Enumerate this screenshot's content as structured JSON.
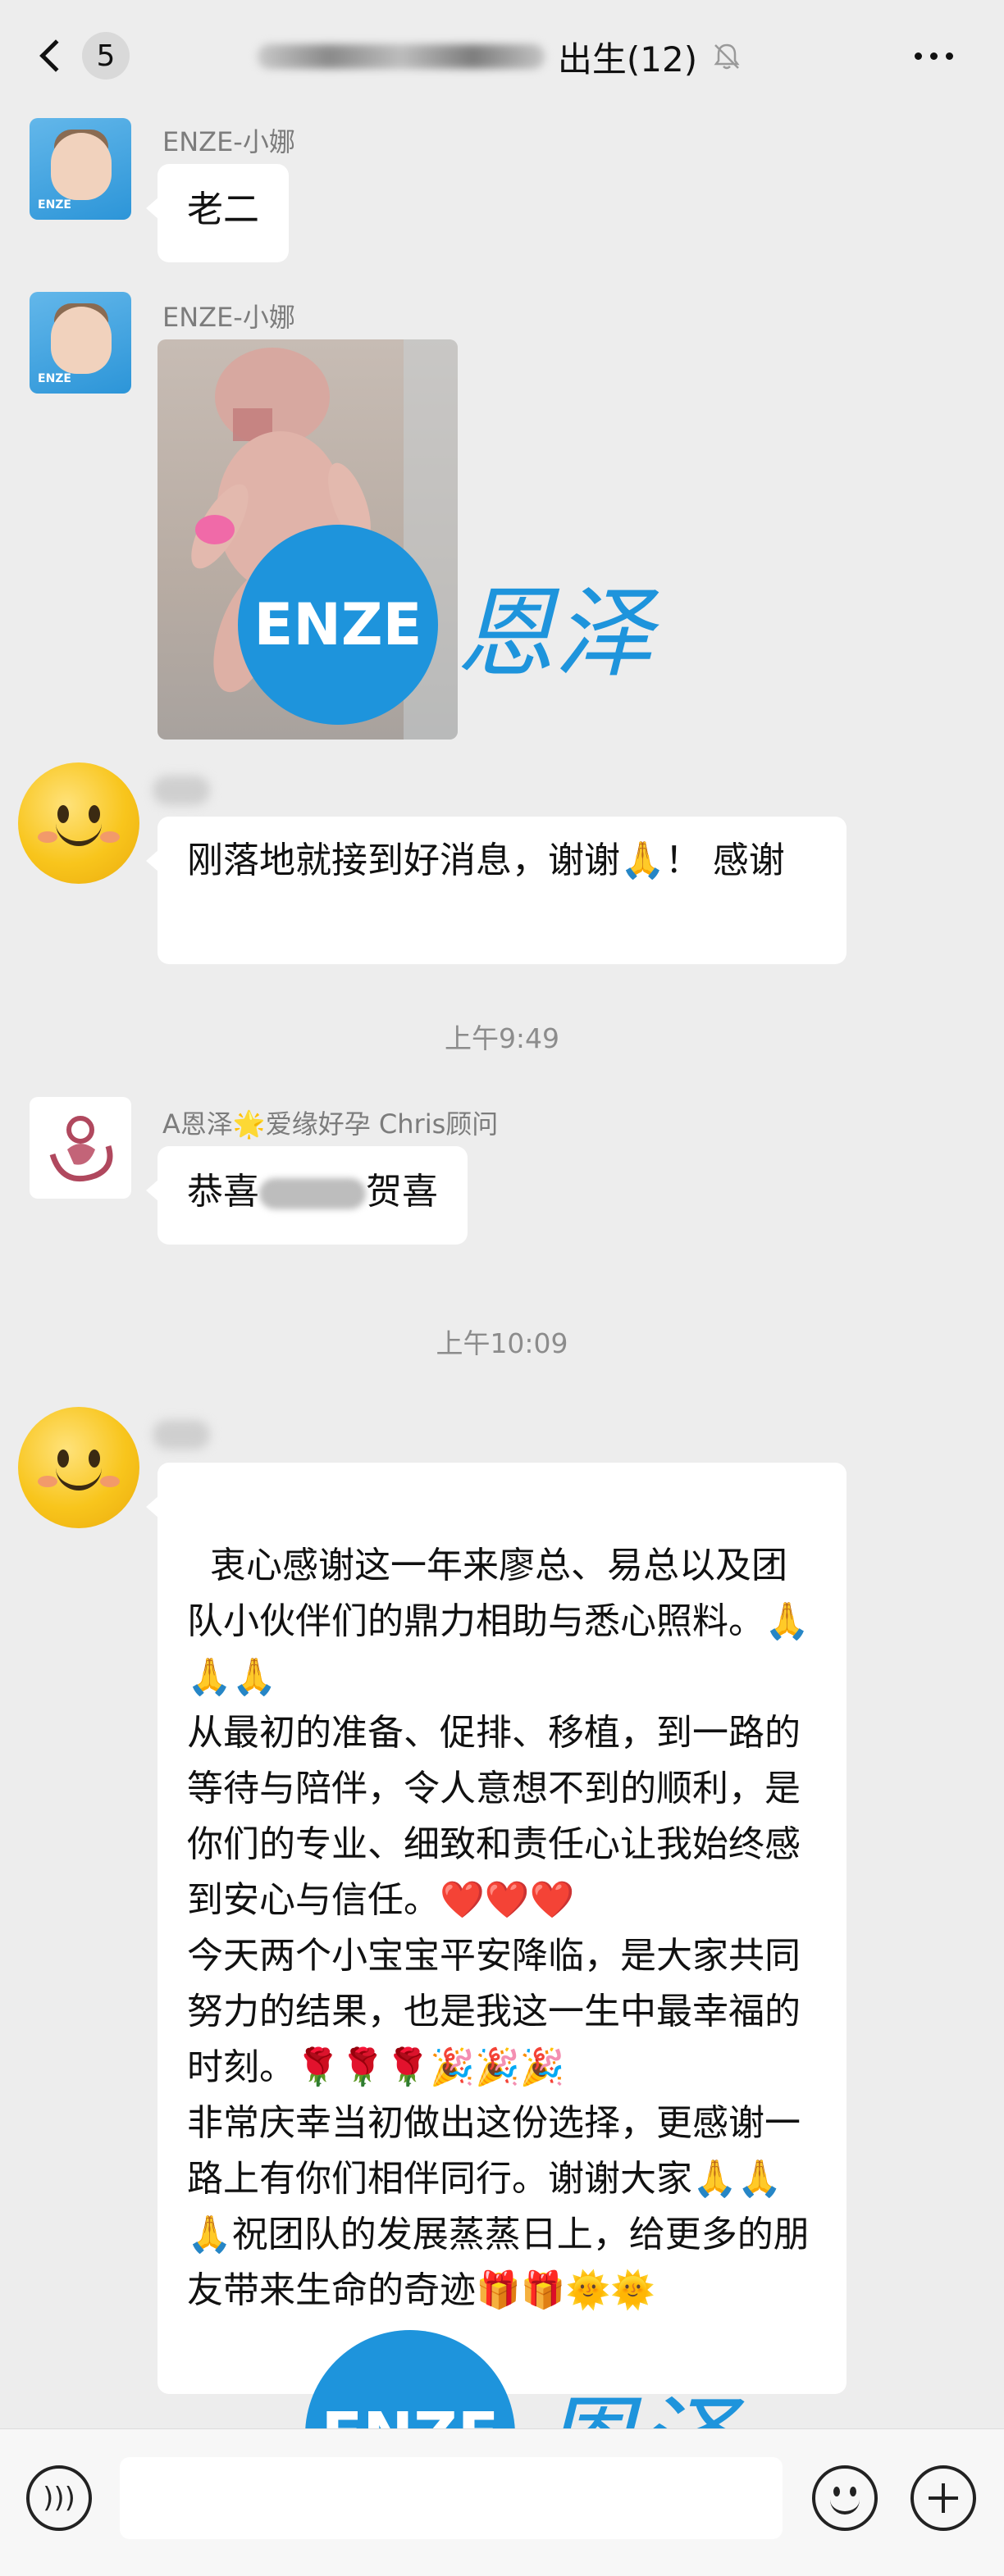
{
  "header": {
    "unread_count": "5",
    "group_title_visible": "出生(12)",
    "back_icon": "chevron-left-icon",
    "mute_icon": "bell-off-icon",
    "more_icon": "more-dots-icon"
  },
  "messages": [
    {
      "sender": "ENZE-小娜",
      "text": "老二"
    },
    {
      "sender": "ENZE-小娜",
      "type": "image"
    },
    {
      "text": "刚落地就接到好消息，谢谢🙏！ 感谢"
    },
    {
      "sender": "A恩泽🌟爱缘好孕 Chris顾问",
      "text_before": "恭喜",
      "text_after": "贺喜"
    },
    {
      "text": "衷心感谢这一年来廖总、易总以及团队小伙伴们的鼎力相助与悉心照料。🙏🙏🙏\n从最初的准备、促排、移植，到一路的等待与陪伴，令人意想不到的顺利，是你们的专业、细致和责任心让我始终感到安心与信任。❤️❤️❤️\n今天两个小宝宝平安降临，是大家共同努力的结果，也是我这一生中最幸福的时刻。🌹🌹🌹🎉🎉🎉\n非常庆幸当初做出这份选择，更感谢一路上有你们相伴同行。谢谢大家🙏🙏🙏祝团队的发展蒸蒸日上，给更多的朋友带来生命的奇迹🎁🎁🌞🌞"
    }
  ],
  "timestamps": [
    "上午9:49",
    "上午10:09"
  ],
  "watermark": {
    "latin": "ENZE",
    "chinese": "恩泽",
    "color": "#1e94dc"
  },
  "input_bar": {
    "voice_icon": "voice-icon",
    "emoji_icon": "emoji-icon",
    "plus_icon": "plus-icon"
  },
  "colors": {
    "background": "#ededed",
    "bubble": "#ffffff",
    "watermark_blue": "#1e94dc"
  }
}
